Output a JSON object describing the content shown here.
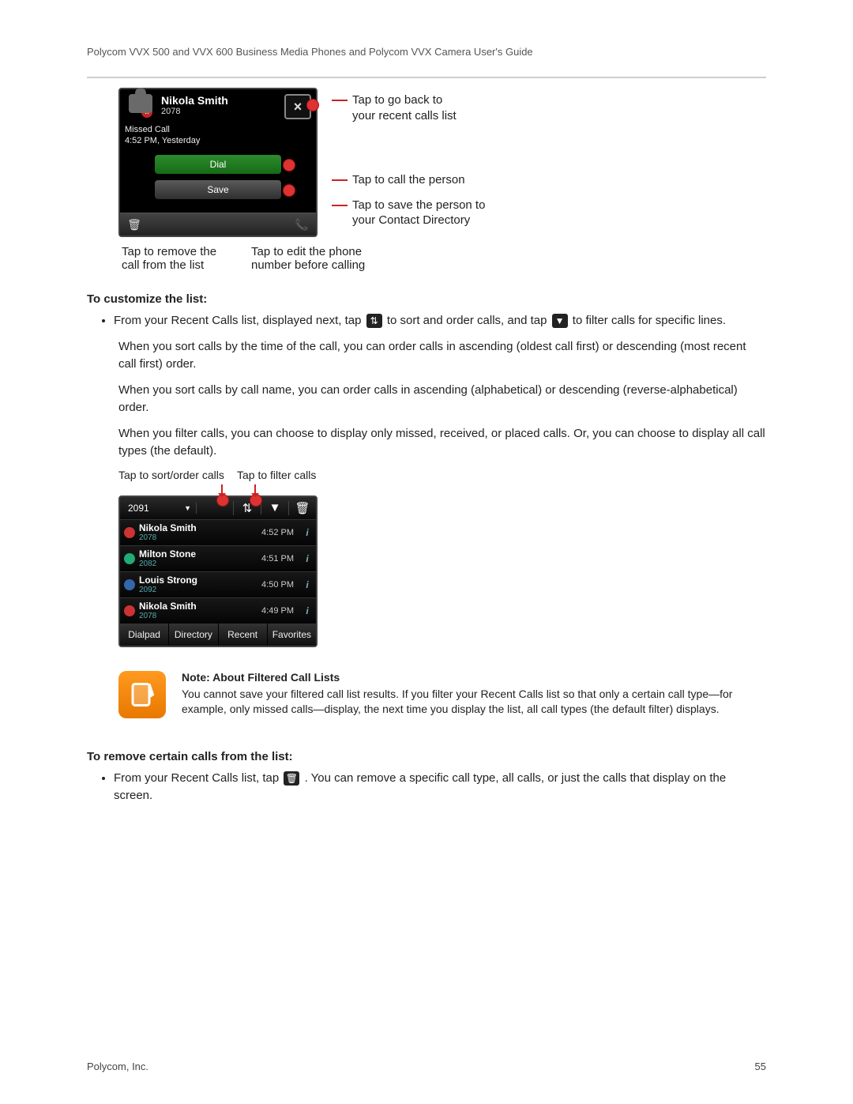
{
  "header": "Polycom VVX 500 and VVX 600 Business Media Phones and Polycom VVX Camera User's Guide",
  "footer": {
    "company": "Polycom, Inc.",
    "page": "55"
  },
  "fig1": {
    "name": "Nikola Smith",
    "ext": "2078",
    "close": "×",
    "missed1": "Missed Call",
    "missed2": "4:52 PM, Yesterday",
    "dial": "Dial",
    "save": "Save",
    "callout_close1": "Tap to go back to",
    "callout_close2": "your recent calls list",
    "callout_dial": "Tap to call the person",
    "callout_save1": "Tap to save the person to",
    "callout_save2": "your Contact Directory",
    "below_left1": "Tap to remove the",
    "below_left2": "call from the list",
    "below_right1": "Tap to edit the phone",
    "below_right2": "number before calling"
  },
  "body": {
    "h1": "To customize the list:",
    "li1a": "From your Recent Calls list, displayed next, tap ",
    "li1b": " to sort and order calls, and tap ",
    "li1c": " to filter calls for specific lines.",
    "p2": "When you sort calls by the time of the call, you can order calls in ascending (oldest call first) or descending (most recent call first) order.",
    "p3": "When you sort calls by call name, you can order calls in ascending (alphabetical) or descending (reverse-alphabetical) order.",
    "p4": "When you filter calls, you can choose to display only missed, received, or placed calls. Or, you can choose to display all call types (the default).",
    "h2": "To remove certain calls from the list:",
    "li2a": "From your Recent Calls list, tap ",
    "li2b": " . You can remove a specific call type, all calls, or just the calls that display on the screen."
  },
  "fig2": {
    "label_sort": "Tap to sort/order calls",
    "label_filter": "Tap to filter calls",
    "dd": "2091",
    "rows": [
      {
        "color": "red",
        "name": "Nikola Smith",
        "ext": "2078",
        "time": "4:52 PM"
      },
      {
        "color": "green",
        "name": "Milton Stone",
        "ext": "2082",
        "time": "4:51 PM"
      },
      {
        "color": "blue",
        "name": "Louis Strong",
        "ext": "2092",
        "time": "4:50 PM"
      },
      {
        "color": "red",
        "name": "Nikola Smith",
        "ext": "2078",
        "time": "4:49 PM"
      }
    ],
    "tabs": [
      "Dialpad",
      "Directory",
      "Recent",
      "Favorites"
    ]
  },
  "note": {
    "title": "Note: About Filtered Call Lists",
    "body": "You cannot save your filtered call list results. If you filter your Recent Calls list so that only a certain call type—for example, only missed calls—display, the next time you display the list, all call types (the default filter) displays."
  },
  "icons": {
    "sort": "⇅",
    "filter": "▼",
    "trash": "🗑"
  }
}
